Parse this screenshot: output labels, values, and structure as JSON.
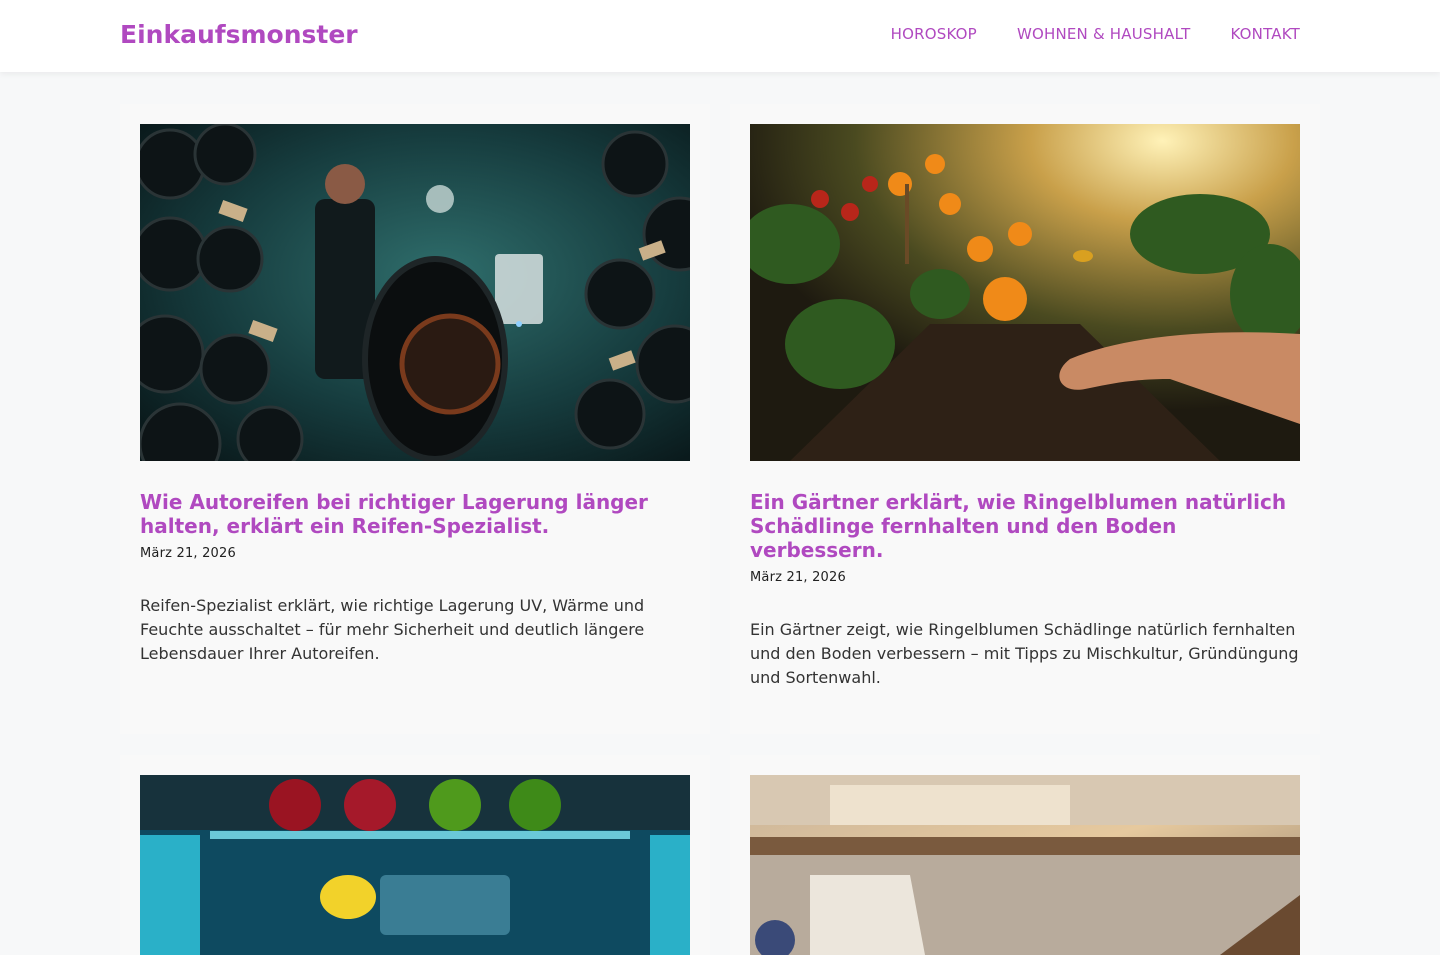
{
  "header": {
    "brand": "Einkaufsmonster",
    "nav": [
      "HOROSKOP",
      "WOHNEN & HAUSHALT",
      "KONTAKT"
    ]
  },
  "colors": {
    "accent": "#b049c0",
    "card_bg": "#f9f9f9",
    "page_bg": "#f7f8f9"
  },
  "posts": [
    {
      "title": "Wie Autoreifen bei richtiger Lagerung länger halten, erklärt ein Reifen-Spezialist.",
      "date": "März 21, 2026",
      "excerpt": "Reifen-Spezialist erklärt, wie richtige Lagerung UV, Wärme und Feuchte ausschaltet – für mehr Sicherheit und deutlich längere Lebensdauer Ihrer Autoreifen."
    },
    {
      "title": "Ein Gärtner erklärt, wie Ringelblumen natürlich Schädlinge fernhalten und den Boden verbessern.",
      "date": "März 21, 2026",
      "excerpt": "Ein Gärtner zeigt, wie Ringelblumen Schädlinge natürlich fernhalten und den Boden verbessern – mit Tipps zu Mischkultur, Gründüngung und Sortenwahl."
    }
  ]
}
